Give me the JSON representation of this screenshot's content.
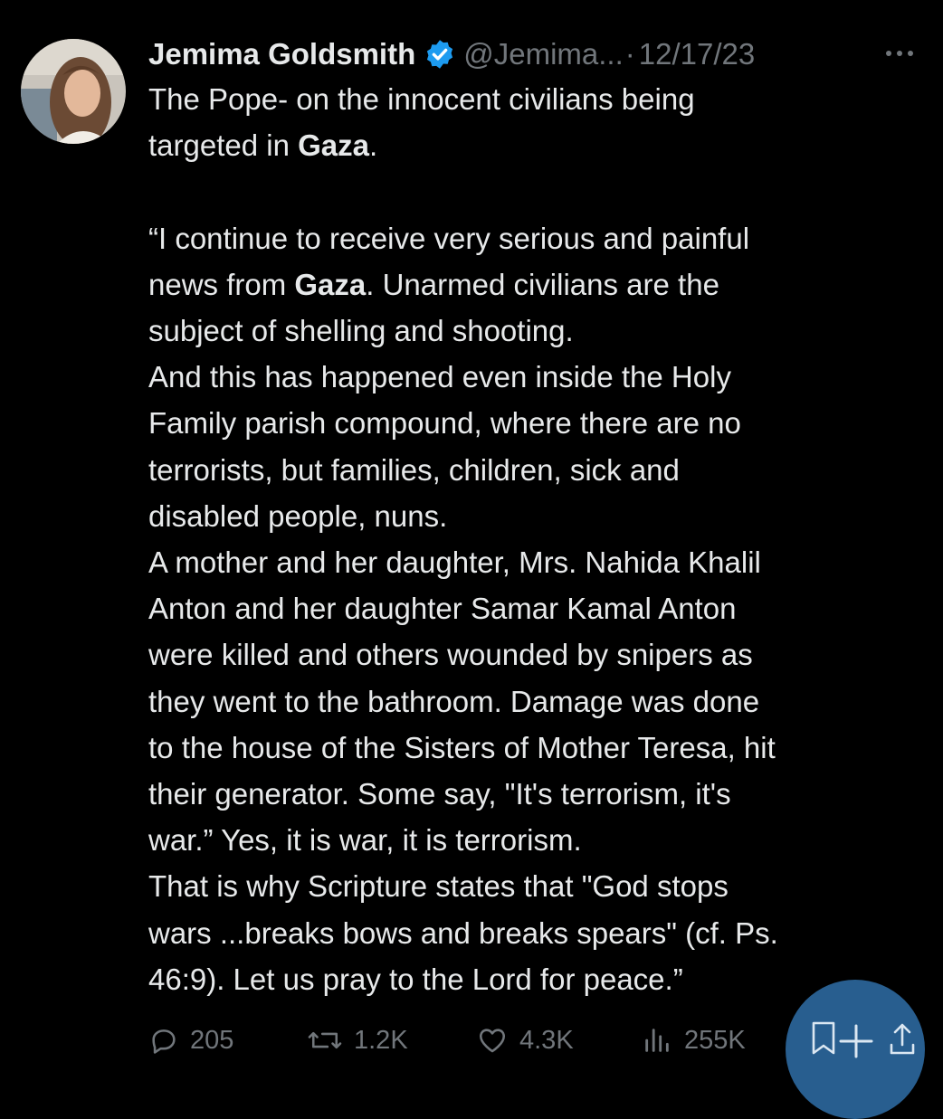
{
  "author": {
    "name": "Jemima Goldsmith",
    "handle": "@Jemima...",
    "separator": "·",
    "date": "12/17/23",
    "verified": true,
    "avatar": "avatar-photo"
  },
  "tweet": {
    "segments": [
      {
        "text": "The Pope- on the innocent civilians being\ntargeted  in ",
        "bold": false
      },
      {
        "text": "Gaza",
        "bold": true
      },
      {
        "text": ".\n\n“I continue to receive very serious and painful\nnews from ",
        "bold": false
      },
      {
        "text": "Gaza",
        "bold": true
      },
      {
        "text": ". Unarmed civilians are the\nsubject of shelling and shooting.\nAnd this has happened even inside the Holy\nFamily parish compound, where there are no\nterrorists, but families, children, sick and\ndisabled people, nuns.\nA mother and her daughter, Mrs. Nahida Khalil\nAnton and her daughter Samar Kamal Anton\nwere killed and others wounded by snipers as\nthey went to the bathroom. Damage was done\nto the house of the Sisters of Mother Teresa, hit\ntheir generator. Some say, \"It's terrorism, it's\nwar.” Yes, it is war, it is terrorism.\nThat is why Scripture states that \"God stops\nwars ...breaks bows and breaks spears\" (cf. Ps.\n46:9). Let us pray to the Lord for peace.”",
        "bold": false
      }
    ]
  },
  "actions": {
    "replies": "205",
    "reposts": "1.2K",
    "likes": "4.3K",
    "views": "255K"
  },
  "icons": {
    "reply": "reply-icon",
    "repost": "repost-icon",
    "like": "heart-icon",
    "views": "views-icon",
    "bookmark": "bookmark-icon",
    "compose": "plus-icon",
    "share": "share-icon",
    "more": "more-icon",
    "verified": "verified-badge-icon"
  },
  "colors": {
    "background": "#000000",
    "text": "#e7e9ea",
    "secondary": "#71767b",
    "verified": "#1d9bf0",
    "fab": "#2f6fa8"
  }
}
